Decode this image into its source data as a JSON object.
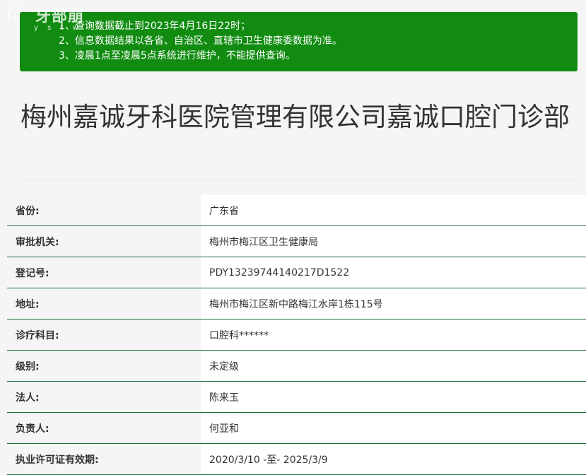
{
  "watermark": {
    "mark": "{/",
    "cn": "牙部崩",
    "en": "y s t w . c"
  },
  "notice": {
    "items": [
      "1、查询数据截止到2023年4月16日22时；",
      "2、信息数据结果以各省、自治区、直辖市卫生健康委数据为准。",
      "3、凌晨1点至凌晨5点系统进行维护，不能提供查询。"
    ],
    "background": "#118c11"
  },
  "title": "梅州嘉诚牙科医院管理有限公司嘉诚口腔门诊部",
  "rows": [
    {
      "label": "省份:",
      "value": "广东省"
    },
    {
      "label": "审批机关:",
      "value": "梅州市梅江区卫生健康局"
    },
    {
      "label": "登记号:",
      "value": "PDY13239744140217D1522"
    },
    {
      "label": "地址:",
      "value": "梅州市梅江区新中路梅江水岸1栋115号"
    },
    {
      "label": "诊疗科目:",
      "value": "口腔科******"
    },
    {
      "label": "级别:",
      "value": "未定级"
    },
    {
      "label": "法人:",
      "value": "陈来玉"
    },
    {
      "label": "负责人:",
      "value": "何亚和"
    },
    {
      "label": "执业许可证有效期:",
      "value": "2020/3/10 -至- 2025/3/9"
    }
  ],
  "colors": {
    "row_divider": "#1a6e3a",
    "page_background": "#f5f5f5"
  }
}
